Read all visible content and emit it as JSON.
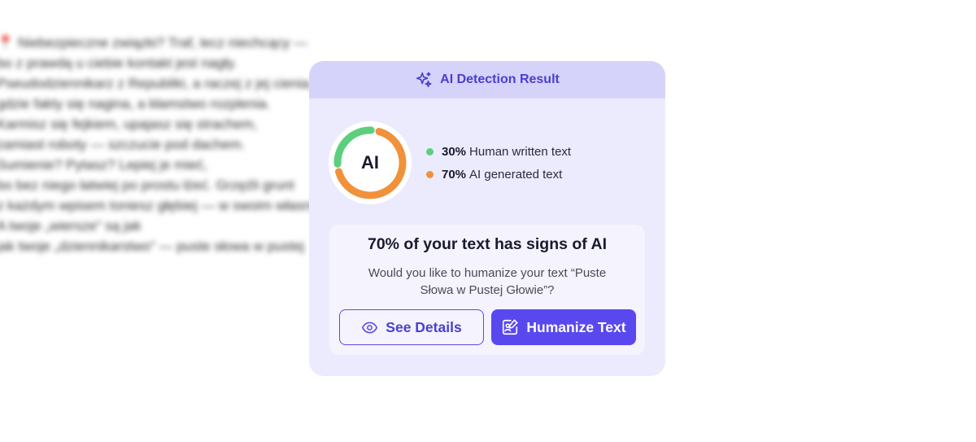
{
  "background_text": {
    "pin_icon": "red-pin-icon",
    "lines": [
      "Niebezpieczne związki? Traf, lecz niechcący —",
      "bo z prawdą u ciebie kontakt jest nagły.",
      "Pseudodziennikarz z Republiki, a raczej z jej cienia,",
      "gdzie fakty się nagina, a kłamstwo rozplenia.",
      "Karmisz się fejkiem, upajasz się strachem,",
      "zamiast roboty — szczucie pod dachem.",
      "Sumienie? Pytasz? Lepiej je mieć,",
      "bo bez niego łatwiej po prostu łżeć. Grzęźli grunt",
      "z każdym wpisem toniesz głębiej — w swoim własnym",
      "A twoje „wiersze” są jak",
      "jak twoje „dziennikarstwo” — puste słowa w pustej"
    ]
  },
  "card": {
    "title": "AI Detection Result",
    "title_icon": "sparkles-icon",
    "donut": {
      "label": "AI",
      "human_percent": 30,
      "ai_percent": 70,
      "human_color": "#5ccf7f",
      "ai_color": "#f0923b"
    },
    "legend": [
      {
        "percent": "30%",
        "label": "Human written text",
        "color": "#5ccf7f"
      },
      {
        "percent": "70%",
        "label": "AI generated text",
        "color": "#f0923b"
      }
    ],
    "headline": "70% of your text has signs of AI",
    "subtext": "Would you like to humanize your text “Puste Słowa w Pustej Głowie”?",
    "buttons": {
      "details_label": "See Details",
      "details_icon": "eye-icon",
      "humanize_label": "Humanize Text",
      "humanize_icon": "humanize-edit-icon"
    },
    "accent": "#5a48ef"
  }
}
